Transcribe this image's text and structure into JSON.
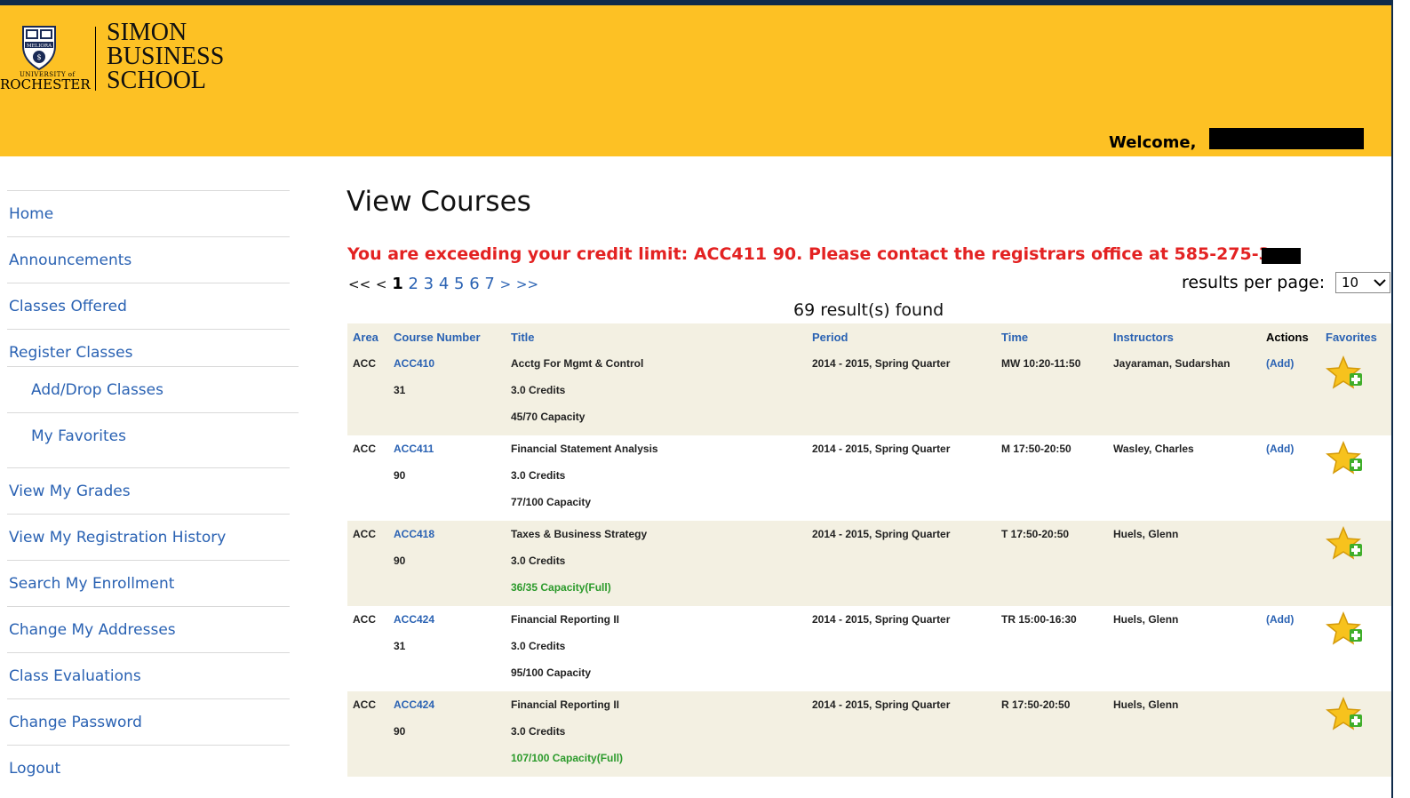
{
  "header": {
    "logo": {
      "school": [
        "SIMON",
        "BUSINESS",
        "SCHOOL"
      ],
      "university_small": "UNIVERSITY of",
      "university_big": "ROCHESTER",
      "seal_text": "MELIORA"
    },
    "welcome": "Welcome,"
  },
  "sidebar": {
    "items": [
      {
        "label": "Home"
      },
      {
        "label": "Announcements"
      },
      {
        "label": "Classes Offered"
      },
      {
        "label": "Register Classes"
      },
      {
        "label": "Add/Drop Classes"
      },
      {
        "label": "My Favorites"
      },
      {
        "label": "View My Grades"
      },
      {
        "label": "View My Registration History"
      },
      {
        "label": "Search My Enrollment"
      },
      {
        "label": "Change My Addresses"
      },
      {
        "label": "Class Evaluations"
      },
      {
        "label": "Change Password"
      },
      {
        "label": "Logout"
      }
    ]
  },
  "main": {
    "title": "View Courses",
    "alert": "You are exceeding your credit limit: ACC411 90. Please contact the registrars office at 585-275-3",
    "pager": {
      "first": "<<",
      "prev": "<",
      "pages": [
        "1",
        "2",
        "3",
        "4",
        "5",
        "6",
        "7"
      ],
      "next": ">",
      "last": ">>"
    },
    "results_per_page_label": "results per page:",
    "results_per_page_value": "10",
    "results_count": "69 result(s) found",
    "table": {
      "headers": {
        "area": "Area",
        "course_number": "Course Number",
        "title": "Title",
        "period": "Period",
        "time": "Time",
        "instructors": "Instructors",
        "actions": "Actions",
        "favorites": "Favorites"
      },
      "rows": [
        {
          "area": "ACC",
          "course": "ACC410",
          "section": "31",
          "title": "Acctg For Mgmt & Control",
          "credits": "3.0 Credits",
          "capacity": "45/70 Capacity",
          "full": false,
          "period": "2014 - 2015, Spring Quarter",
          "time": "MW 10:20-11:50",
          "instructors": "Jayaraman, Sudarshan",
          "action": "(Add)"
        },
        {
          "area": "ACC",
          "course": "ACC411",
          "section": "90",
          "title": "Financial Statement Analysis",
          "credits": "3.0 Credits",
          "capacity": "77/100 Capacity",
          "full": false,
          "period": "2014 - 2015, Spring Quarter",
          "time": "M 17:50-20:50",
          "instructors": "Wasley, Charles",
          "action": "(Add)"
        },
        {
          "area": "ACC",
          "course": "ACC418",
          "section": "90",
          "title": "Taxes & Business Strategy",
          "credits": "3.0 Credits",
          "capacity": "36/35 Capacity(Full)",
          "full": true,
          "period": "2014 - 2015, Spring Quarter",
          "time": "T 17:50-20:50",
          "instructors": "Huels, Glenn",
          "action": ""
        },
        {
          "area": "ACC",
          "course": "ACC424",
          "section": "31",
          "title": "Financial Reporting II",
          "credits": "3.0 Credits",
          "capacity": "95/100 Capacity",
          "full": false,
          "period": "2014 - 2015, Spring Quarter",
          "time": "TR 15:00-16:30",
          "instructors": "Huels, Glenn",
          "action": "(Add)"
        },
        {
          "area": "ACC",
          "course": "ACC424",
          "section": "90",
          "title": "Financial Reporting II",
          "credits": "3.0 Credits",
          "capacity": "107/100 Capacity(Full)",
          "full": true,
          "period": "2014 - 2015, Spring Quarter",
          "time": "R 17:50-20:50",
          "instructors": "Huels, Glenn",
          "action": ""
        }
      ]
    }
  },
  "colors": {
    "header_bg": "#fdc124",
    "link_blue": "#2a62b3",
    "alert_red": "#e32222",
    "full_green": "#2b9a2b",
    "row_shade": "#f3f0e2"
  },
  "icons": {
    "favorite": "star-plus-icon",
    "seal": "university-seal-icon",
    "select_arrow": "chevron-down-icon"
  }
}
